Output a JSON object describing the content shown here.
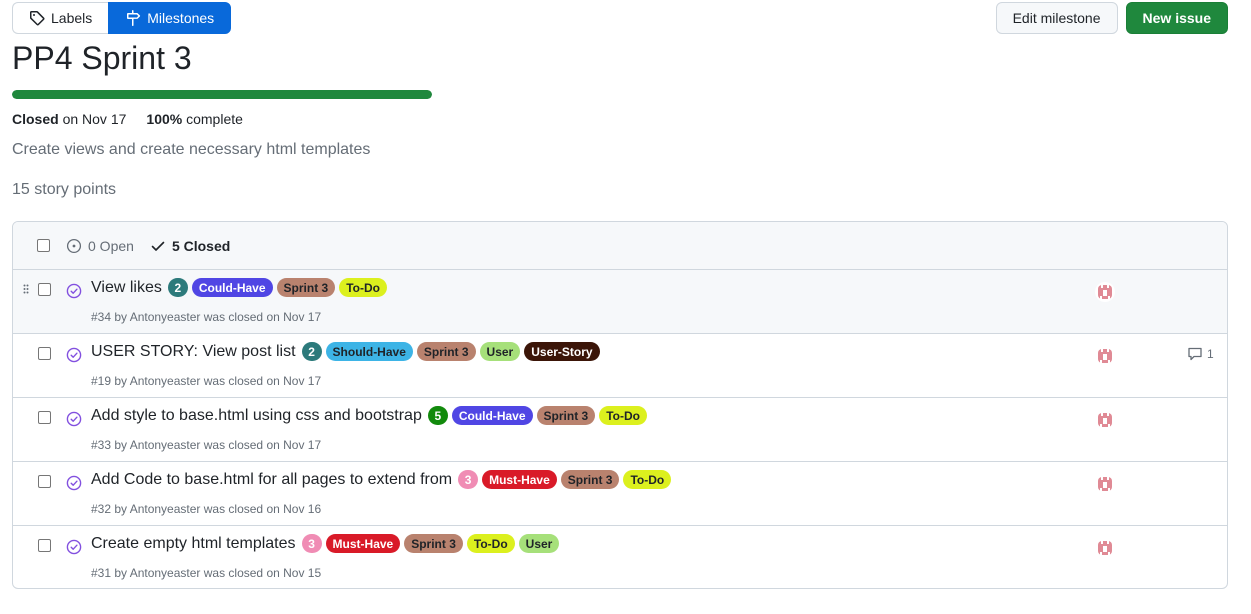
{
  "nav": {
    "labels_tab": "Labels",
    "milestones_tab": "Milestones",
    "edit_milestone": "Edit milestone",
    "new_issue": "New issue"
  },
  "milestone": {
    "title": "PP4 Sprint 3",
    "progress_percent": 100,
    "closed_label": "Closed",
    "closed_date": "on Nov 17",
    "complete_percent": "100%",
    "complete_label": "complete",
    "description": "Create views and create necessary html templates",
    "story_points": "15 story points"
  },
  "filters": {
    "open": "0 Open",
    "closed": "5 Closed"
  },
  "colors": {
    "accent": "#0969da",
    "primary_button": "#1f883d",
    "closed_icon": "#8250df"
  },
  "issues": [
    {
      "title": "View likes",
      "count": "2",
      "count_color": "#2c7a7b",
      "labels": [
        {
          "text": "Could-Have",
          "bg": "#5046e4",
          "fg": "#ffffff"
        },
        {
          "text": "Sprint 3",
          "bg": "#b9826e",
          "fg": "#1f2328"
        },
        {
          "text": "To-Do",
          "bg": "#dcf01e",
          "fg": "#1f2328"
        }
      ],
      "meta": "#34 by Antonyeaster was closed on Nov 17",
      "comments": ""
    },
    {
      "title": "USER STORY: View post list",
      "count": "2",
      "count_color": "#2c7a7b",
      "labels": [
        {
          "text": "Should-Have",
          "bg": "#3db4e6",
          "fg": "#1f2328"
        },
        {
          "text": "Sprint 3",
          "bg": "#b9826e",
          "fg": "#1f2328"
        },
        {
          "text": "User",
          "bg": "#a6e07a",
          "fg": "#1f2328"
        },
        {
          "text": "User-Story",
          "bg": "#3b1508",
          "fg": "#ffffff"
        }
      ],
      "meta": "#19 by Antonyeaster was closed on Nov 17",
      "comments": "1"
    },
    {
      "title": "Add style to base.html using css and bootstrap",
      "count": "5",
      "count_color": "#128a0c",
      "labels": [
        {
          "text": "Could-Have",
          "bg": "#5046e4",
          "fg": "#ffffff"
        },
        {
          "text": "Sprint 3",
          "bg": "#b9826e",
          "fg": "#1f2328"
        },
        {
          "text": "To-Do",
          "bg": "#dcf01e",
          "fg": "#1f2328"
        }
      ],
      "meta": "#33 by Antonyeaster was closed on Nov 17",
      "comments": ""
    },
    {
      "title": "Add Code to base.html for all pages to extend from",
      "count": "3",
      "count_color": "#f08cb4",
      "labels": [
        {
          "text": "Must-Have",
          "bg": "#d91a28",
          "fg": "#ffffff"
        },
        {
          "text": "Sprint 3",
          "bg": "#b9826e",
          "fg": "#1f2328"
        },
        {
          "text": "To-Do",
          "bg": "#dcf01e",
          "fg": "#1f2328"
        }
      ],
      "meta": "#32 by Antonyeaster was closed on Nov 16",
      "comments": ""
    },
    {
      "title": "Create empty html templates",
      "count": "3",
      "count_color": "#f08cb4",
      "labels": [
        {
          "text": "Must-Have",
          "bg": "#d91a28",
          "fg": "#ffffff"
        },
        {
          "text": "Sprint 3",
          "bg": "#b9826e",
          "fg": "#1f2328"
        },
        {
          "text": "To-Do",
          "bg": "#dcf01e",
          "fg": "#1f2328"
        },
        {
          "text": "User",
          "bg": "#a6e07a",
          "fg": "#1f2328"
        }
      ],
      "meta": "#31 by Antonyeaster was closed on Nov 15",
      "comments": ""
    }
  ]
}
